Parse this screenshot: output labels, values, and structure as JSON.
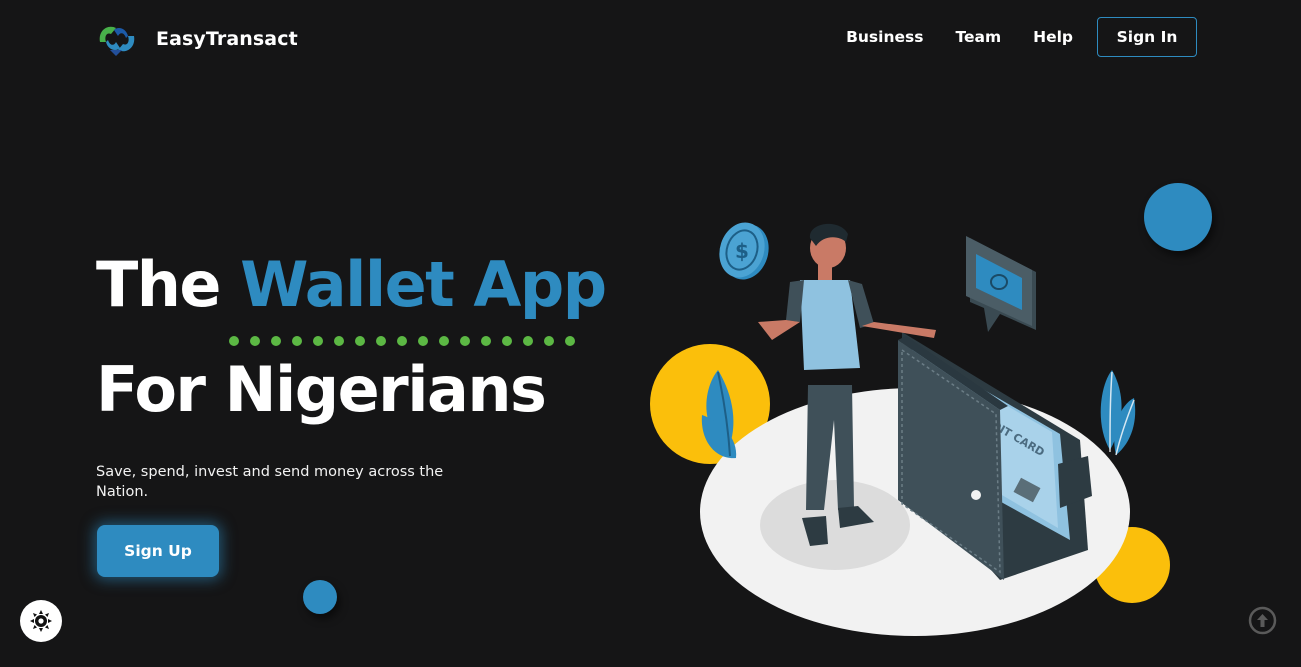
{
  "brand": {
    "name": "EasyTransact",
    "logo_icon": "easytransact-logo-icon"
  },
  "nav": {
    "links": [
      "Business",
      "Team",
      "Help"
    ],
    "signin_label": "Sign In"
  },
  "hero": {
    "title_part1": "The ",
    "title_accent": "Wallet App",
    "title_line2": "For Nigerians",
    "subtitle": "Save, spend, invest and send money across the Nation.",
    "signup_label": "Sign Up"
  },
  "illustration": {
    "label_card": "CREDIT CARD",
    "icons": [
      "dollar-coin-icon",
      "money-chat-bubble-icon",
      "wallet-icon",
      "leaf-icon"
    ]
  },
  "controls": {
    "theme_toggle_icon": "sun-icon",
    "scroll_top_icon": "arrow-up-circle-icon"
  },
  "colors": {
    "background": "#151516",
    "accent": "#2e8bc0",
    "dot_green": "#5cb844",
    "yellow": "#fbbf0b"
  }
}
